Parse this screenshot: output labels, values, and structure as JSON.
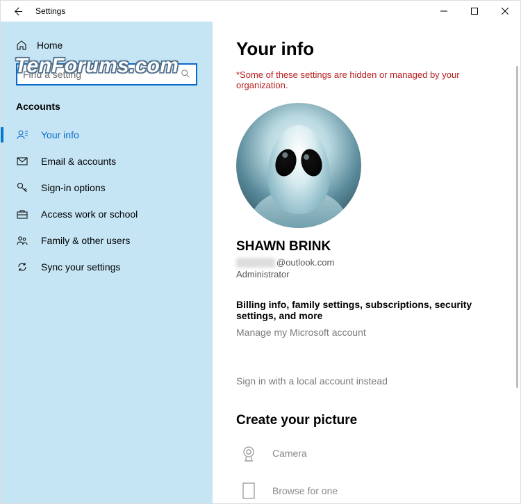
{
  "titlebar": {
    "title": "Settings"
  },
  "sidebar": {
    "home_label": "Home",
    "search_placeholder": "Find a setting",
    "section_title": "Accounts",
    "items": [
      {
        "label": "Your info"
      },
      {
        "label": "Email & accounts"
      },
      {
        "label": "Sign-in options"
      },
      {
        "label": "Access work or school"
      },
      {
        "label": "Family & other users"
      },
      {
        "label": "Sync your settings"
      }
    ]
  },
  "main": {
    "page_title": "Your info",
    "org_notice": "*Some of these settings are hidden or managed by your organization.",
    "user_name": "SHAWN BRINK",
    "email_suffix": "@outlook.com",
    "user_role": "Administrator",
    "billing_heading": "Billing info, family settings, subscriptions, security settings, and more",
    "manage_link": "Manage my Microsoft account",
    "local_link": "Sign in with a local account instead",
    "create_title": "Create your picture",
    "camera_label": "Camera",
    "browse_label": "Browse for one"
  },
  "watermark": "TenForums.com"
}
